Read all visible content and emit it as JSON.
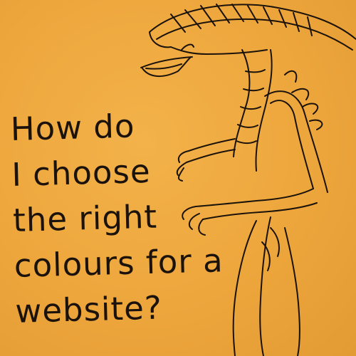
{
  "note": {
    "background_color": "#eda63c",
    "ink_color": "#1b130b",
    "text_lines": [
      "How do",
      "I choose",
      "the right",
      "colours for a",
      "website?"
    ]
  },
  "illustration": {
    "subject": "alien-creature-sketch"
  }
}
